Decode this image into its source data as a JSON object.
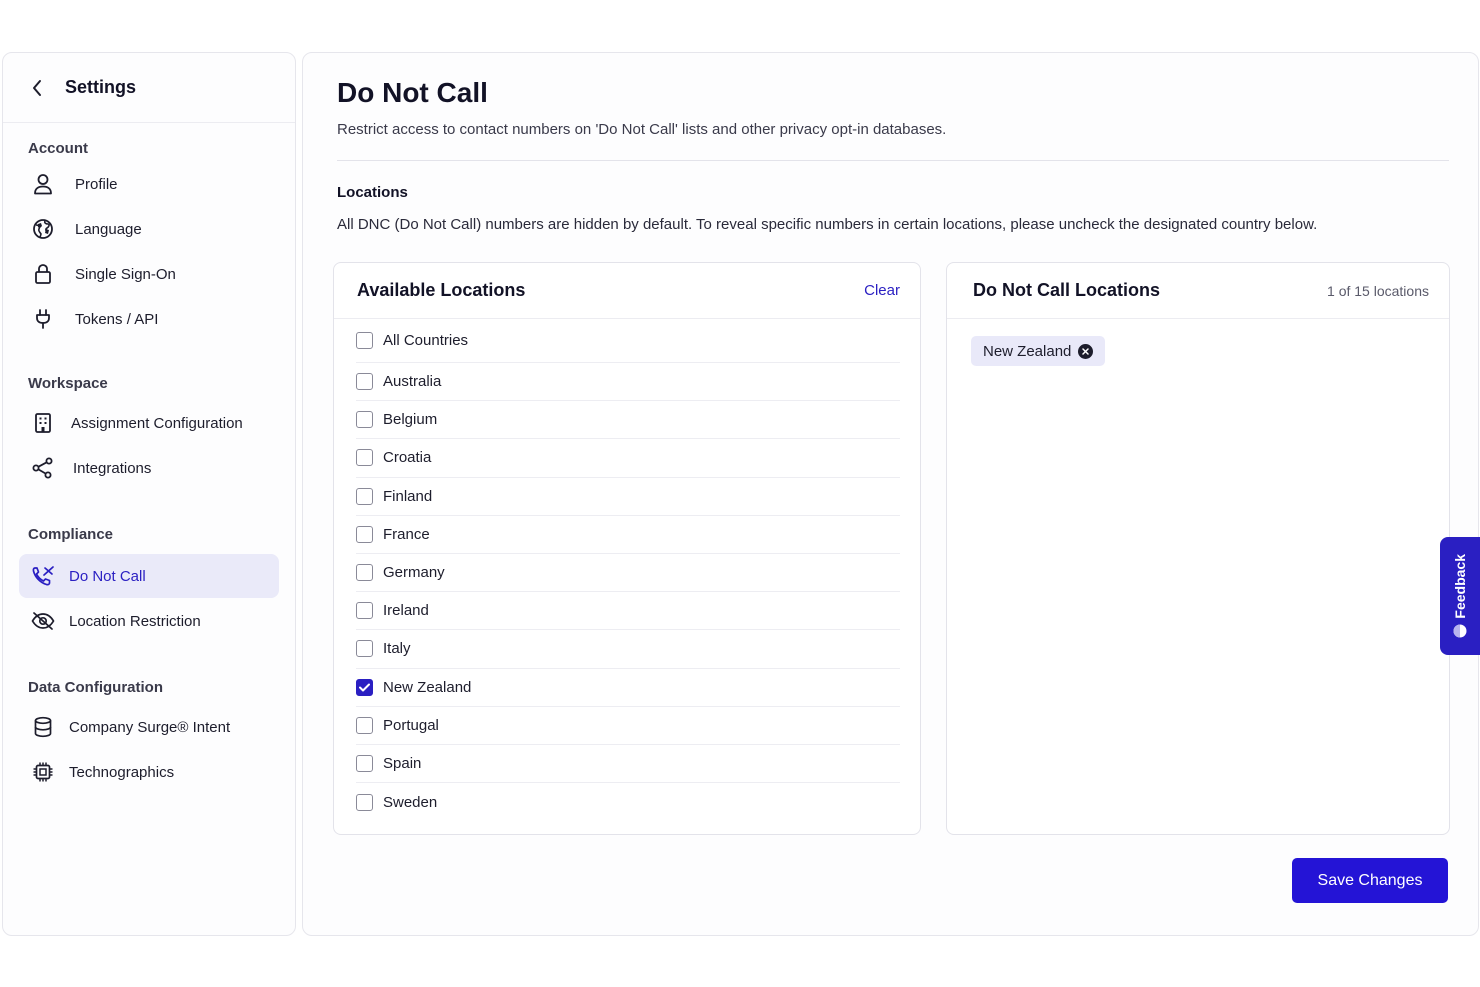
{
  "sidebar": {
    "title": "Settings",
    "sections": [
      {
        "title": "Account",
        "items": [
          {
            "label": "Profile",
            "icon": "user-icon"
          },
          {
            "label": "Language",
            "icon": "globe-icon"
          },
          {
            "label": "Single Sign-On",
            "icon": "lock-icon"
          },
          {
            "label": "Tokens / API",
            "icon": "plug-icon"
          }
        ]
      },
      {
        "title": "Workspace",
        "items": [
          {
            "label": "Assignment Configuration",
            "icon": "building-icon"
          },
          {
            "label": "Integrations",
            "icon": "share-icon"
          }
        ]
      },
      {
        "title": "Compliance",
        "items": [
          {
            "label": "Do Not Call",
            "icon": "phone-off-icon",
            "active": true
          },
          {
            "label": "Location Restriction",
            "icon": "eye-off-icon"
          }
        ]
      },
      {
        "title": "Data Configuration",
        "items": [
          {
            "label": "Company Surge® Intent",
            "icon": "database-icon"
          },
          {
            "label": "Technographics",
            "icon": "chip-icon"
          }
        ]
      }
    ]
  },
  "main": {
    "title": "Do Not Call",
    "description": "Restrict access to contact numbers on 'Do Not Call' lists and other privacy opt-in databases.",
    "locations_title": "Locations",
    "locations_description": "All DNC (Do Not Call) numbers are hidden by default. To reveal specific numbers in certain locations, please uncheck the designated country below.",
    "available": {
      "title": "Available Locations",
      "clear_label": "Clear",
      "countries": [
        {
          "name": "All Countries",
          "checked": false
        },
        {
          "name": "Australia",
          "checked": false
        },
        {
          "name": "Belgium",
          "checked": false
        },
        {
          "name": "Croatia",
          "checked": false
        },
        {
          "name": "Finland",
          "checked": false
        },
        {
          "name": "France",
          "checked": false
        },
        {
          "name": "Germany",
          "checked": false
        },
        {
          "name": "Ireland",
          "checked": false
        },
        {
          "name": "Italy",
          "checked": false
        },
        {
          "name": "New Zealand",
          "checked": true
        },
        {
          "name": "Portugal",
          "checked": false
        },
        {
          "name": "Spain",
          "checked": false
        },
        {
          "name": "Sweden",
          "checked": false
        }
      ]
    },
    "dnc": {
      "title": "Do Not Call Locations",
      "count": "1 of 15 locations",
      "selected": [
        "New Zealand"
      ]
    },
    "save_label": "Save Changes"
  },
  "feedback": {
    "label": "Feedback"
  },
  "colors": {
    "accent": "#2a1fc2",
    "button": "#2414d6",
    "active_bg": "#eaeaf9"
  }
}
